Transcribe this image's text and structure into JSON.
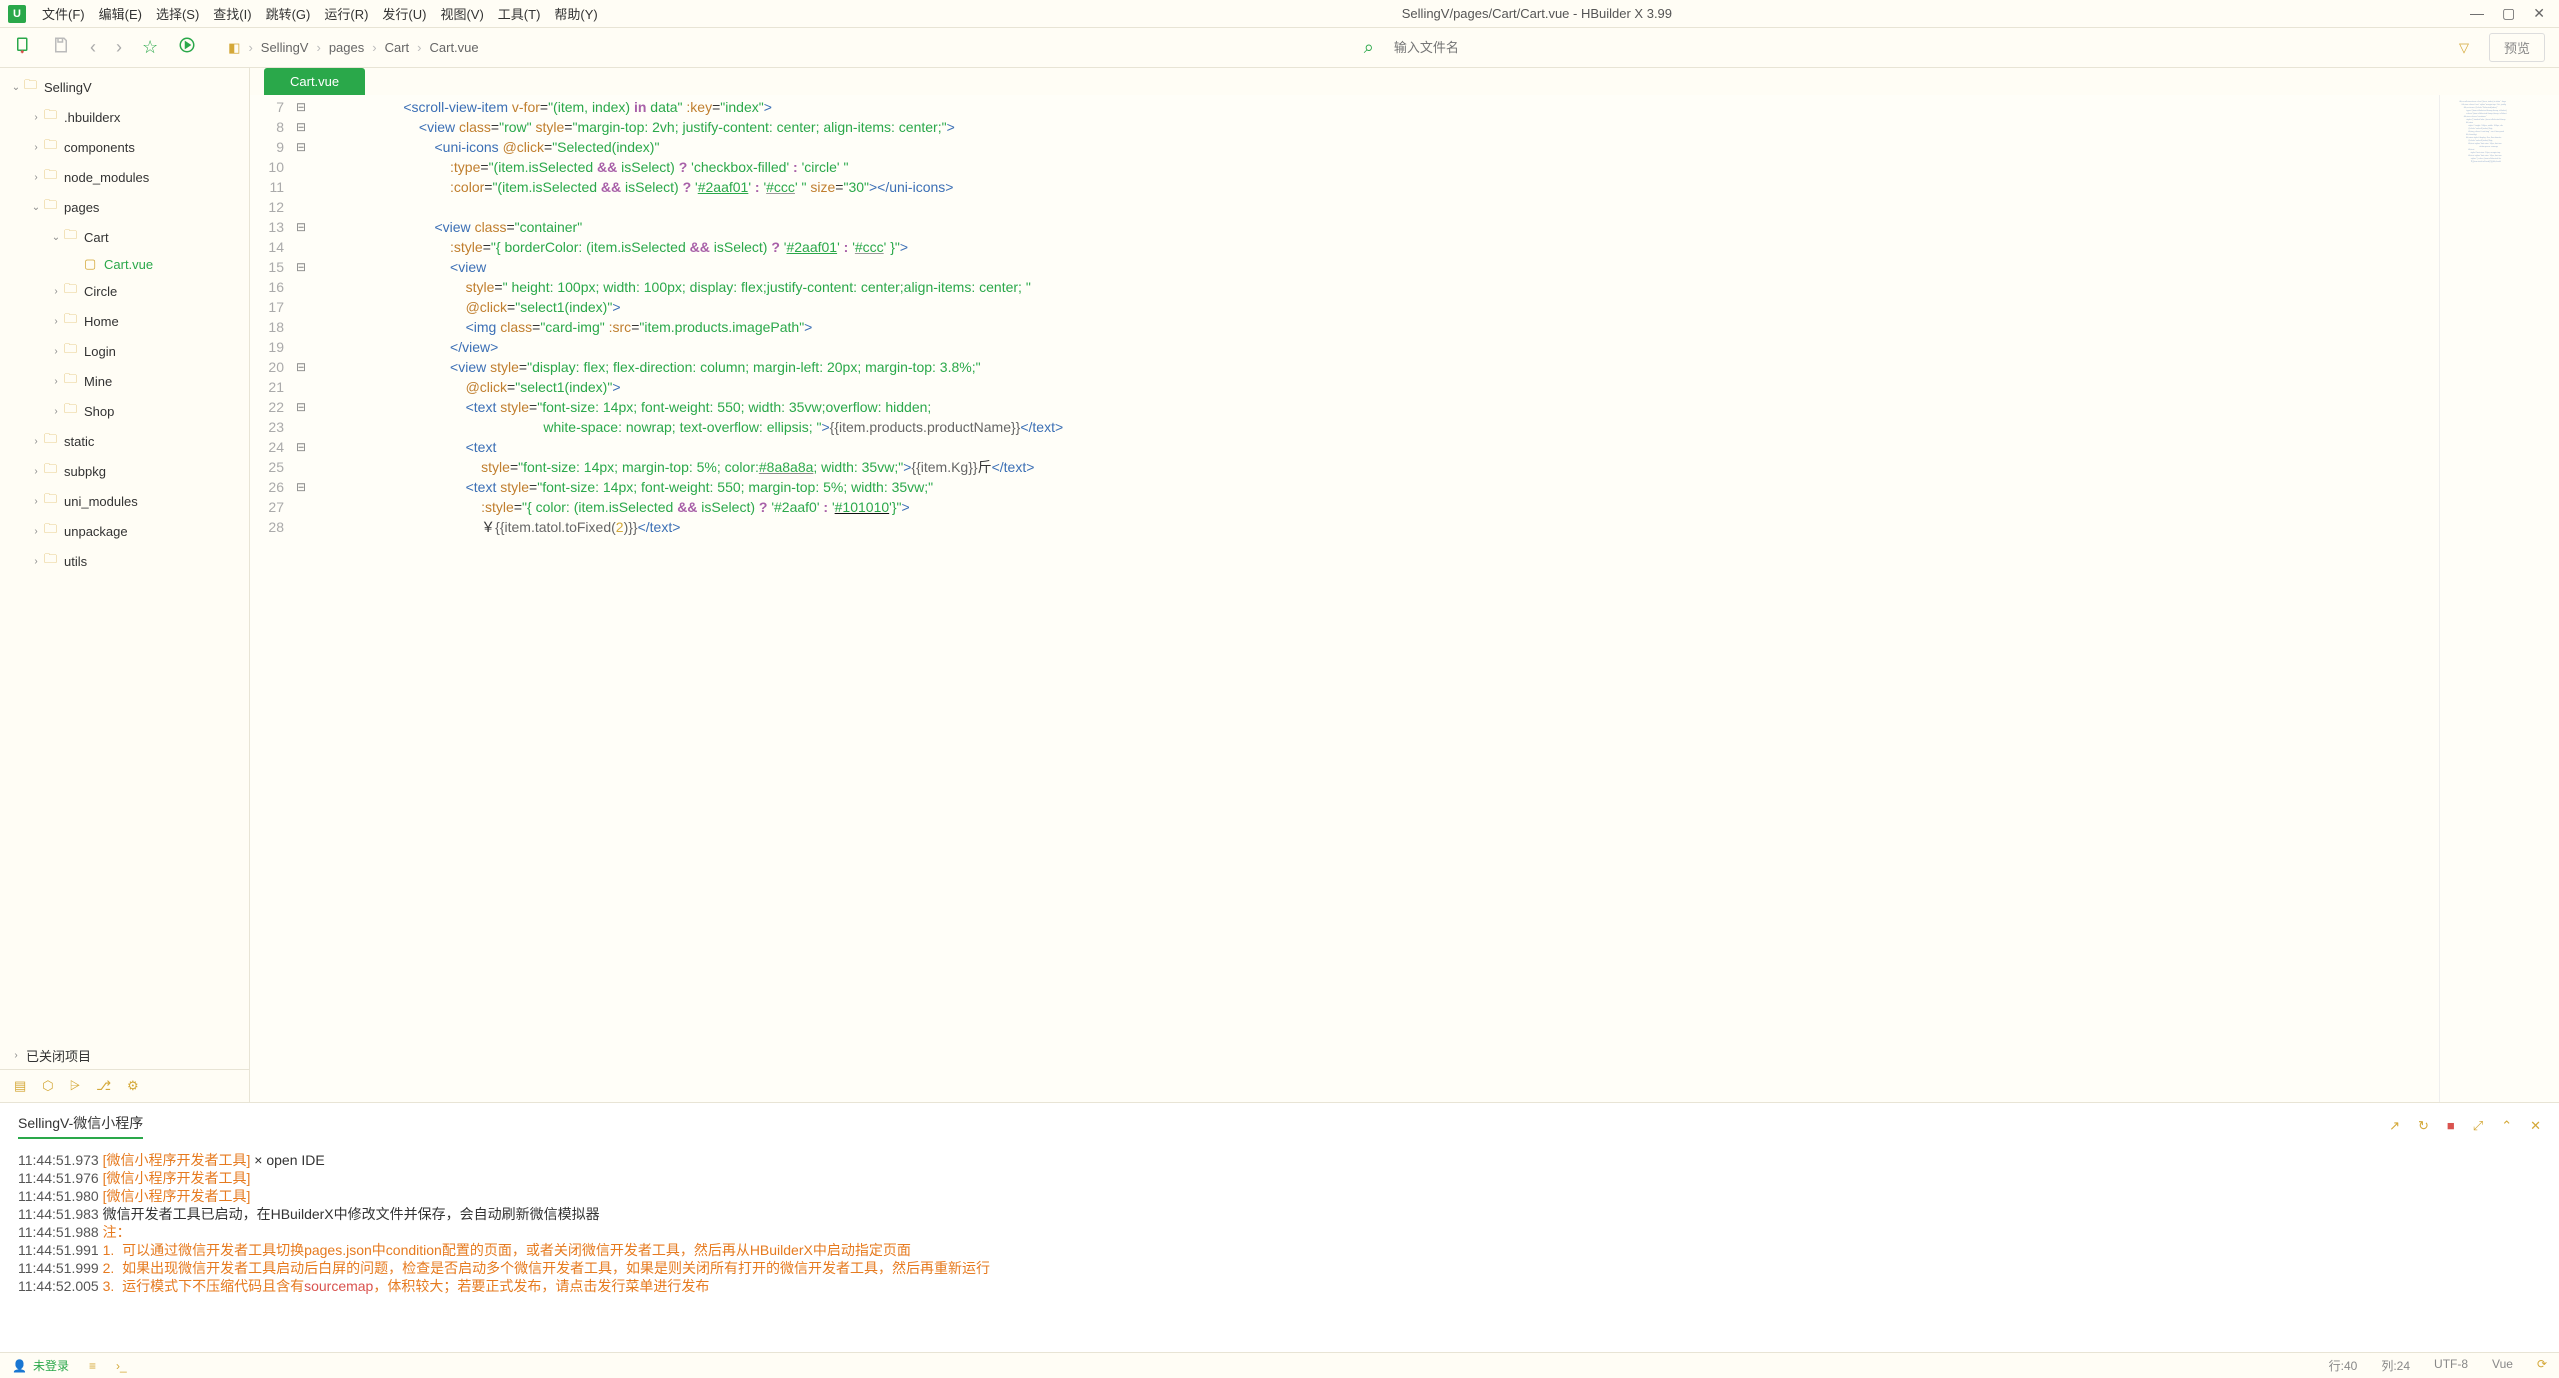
{
  "app": {
    "title": "SellingV/pages/Cart/Cart.vue - HBuilder X 3.99"
  },
  "menubar": {
    "items": [
      {
        "label": "文件(F)"
      },
      {
        "label": "编辑(E)"
      },
      {
        "label": "选择(S)"
      },
      {
        "label": "查找(I)"
      },
      {
        "label": "跳转(G)"
      },
      {
        "label": "运行(R)"
      },
      {
        "label": "发行(U)"
      },
      {
        "label": "视图(V)"
      },
      {
        "label": "工具(T)"
      },
      {
        "label": "帮助(Y)"
      }
    ]
  },
  "toolbar": {
    "search_placeholder": "输入文件名",
    "preview_label": "预览"
  },
  "breadcrumb": {
    "items": [
      "SellingV",
      "pages",
      "Cart",
      "Cart.vue"
    ]
  },
  "sidebar": {
    "items": [
      {
        "indent": 0,
        "chevron": "down",
        "icon": "proj",
        "label": "SellingV"
      },
      {
        "indent": 1,
        "chevron": "right",
        "icon": "folder",
        "label": ".hbuilderx"
      },
      {
        "indent": 1,
        "chevron": "right",
        "icon": "folder",
        "label": "components"
      },
      {
        "indent": 1,
        "chevron": "right",
        "icon": "folder",
        "label": "node_modules"
      },
      {
        "indent": 1,
        "chevron": "down",
        "icon": "folder",
        "label": "pages"
      },
      {
        "indent": 2,
        "chevron": "down",
        "icon": "folder",
        "label": "Cart"
      },
      {
        "indent": 3,
        "chevron": "",
        "icon": "file",
        "label": "Cart.vue",
        "active": true
      },
      {
        "indent": 2,
        "chevron": "right",
        "icon": "folder",
        "label": "Circle"
      },
      {
        "indent": 2,
        "chevron": "right",
        "icon": "folder",
        "label": "Home"
      },
      {
        "indent": 2,
        "chevron": "right",
        "icon": "folder",
        "label": "Login"
      },
      {
        "indent": 2,
        "chevron": "right",
        "icon": "folder",
        "label": "Mine"
      },
      {
        "indent": 2,
        "chevron": "right",
        "icon": "folder",
        "label": "Shop"
      },
      {
        "indent": 1,
        "chevron": "right",
        "icon": "folder",
        "label": "static"
      },
      {
        "indent": 1,
        "chevron": "right",
        "icon": "folder",
        "label": "subpkg"
      },
      {
        "indent": 1,
        "chevron": "right",
        "icon": "folder",
        "label": "uni_modules"
      },
      {
        "indent": 1,
        "chevron": "right",
        "icon": "folder",
        "label": "unpackage"
      },
      {
        "indent": 1,
        "chevron": "right",
        "icon": "folder",
        "label": "utils"
      }
    ],
    "closed_projects": "已关闭项目"
  },
  "tabs": {
    "active": "Cart.vue"
  },
  "editor": {
    "lines": [
      {
        "n": 7,
        "fold": "−",
        "html": "                        <span class='tag-bracket'>&lt;</span><span class='tag-name'>scroll-view-item</span> <span class='attr-name'>v-for</span>=<span class='attr-val'>\"(item, index) </span><span class='keyword'>in</span><span class='attr-val'> data\"</span> <span class='attr-name'>:key</span>=<span class='attr-val'>\"index\"</span><span class='tag-bracket'>&gt;</span>"
      },
      {
        "n": 8,
        "fold": "−",
        "html": "                            <span class='tag-bracket'>&lt;</span><span class='tag-name'>view</span> <span class='attr-name'>class</span>=<span class='attr-val'>\"row\"</span> <span class='attr-name'>style</span>=<span class='attr-val'>\"margin-top: 2vh; justify-content: center; align-items: center;\"</span><span class='tag-bracket'>&gt;</span>"
      },
      {
        "n": 9,
        "fold": "−",
        "html": "                                <span class='tag-bracket'>&lt;</span><span class='tag-name'>uni-icons</span> <span class='attr-name'>@click</span>=<span class='attr-val'>\"Selected(index)\"</span>"
      },
      {
        "n": 10,
        "fold": "",
        "html": "                                    <span class='attr-name'>:type</span>=<span class='attr-val'>\"(item.isSelected </span><span class='keyword'>&amp;&amp;</span><span class='attr-val'> isSelect) </span><span class='keyword'>?</span><span class='attr-val'> 'checkbox-filled' </span><span class='keyword'>:</span><span class='attr-val'> 'circle' \"</span>"
      },
      {
        "n": 11,
        "fold": "",
        "html": "                                    <span class='attr-name'>:color</span>=<span class='attr-val'>\"(item.isSelected </span><span class='keyword'>&amp;&amp;</span><span class='attr-val'> isSelect) </span><span class='keyword'>?</span><span class='attr-val'> '</span><span class='hex-green'>#2aaf01</span><span class='attr-val'>' </span><span class='keyword'>:</span><span class='attr-val'> '</span><span class='hex-ccc'>#ccc</span><span class='attr-val'>' \"</span> <span class='attr-name'>size</span>=<span class='attr-val'>\"30\"</span><span class='tag-bracket'>&gt;&lt;/</span><span class='tag-name'>uni-icons</span><span class='tag-bracket'>&gt;</span>"
      },
      {
        "n": 12,
        "fold": "",
        "html": ""
      },
      {
        "n": 13,
        "fold": "−",
        "html": "                                <span class='tag-bracket'>&lt;</span><span class='tag-name'>view</span> <span class='attr-name'>class</span>=<span class='attr-val'>\"container\"</span>"
      },
      {
        "n": 14,
        "fold": "",
        "html": "                                    <span class='attr-name'>:style</span>=<span class='attr-val'>\"{ borderColor: (item.isSelected </span><span class='keyword'>&amp;&amp;</span><span class='attr-val'> isSelect) </span><span class='keyword'>?</span><span class='attr-val'> '</span><span class='hex-green'>#2aaf01</span><span class='attr-val'>' </span><span class='keyword'>:</span><span class='attr-val'> '</span><span class='hex-ccc'>#ccc</span><span class='attr-val'>' }\"</span><span class='tag-bracket'>&gt;</span>"
      },
      {
        "n": 15,
        "fold": "−",
        "html": "                                    <span class='tag-bracket'>&lt;</span><span class='tag-name'>view</span>"
      },
      {
        "n": 16,
        "fold": "",
        "html": "                                        <span class='attr-name'>style</span>=<span class='attr-val'>\" height: 100px; width: 100px; display: flex;justify-content: center;align-items: center; \"</span>"
      },
      {
        "n": 17,
        "fold": "",
        "html": "                                        <span class='attr-name'>@click</span>=<span class='attr-val'>\"select1(index)\"</span><span class='tag-bracket'>&gt;</span>"
      },
      {
        "n": 18,
        "fold": "",
        "html": "                                        <span class='tag-bracket'>&lt;</span><span class='tag-name'>img</span> <span class='attr-name'>class</span>=<span class='attr-val'>\"card-img\"</span> <span class='attr-name'>:src</span>=<span class='attr-val'>\"item.products.imagePath\"</span><span class='tag-bracket'>&gt;</span>"
      },
      {
        "n": 19,
        "fold": "",
        "html": "                                    <span class='tag-bracket'>&lt;/</span><span class='tag-name'>view</span><span class='tag-bracket'>&gt;</span>"
      },
      {
        "n": 20,
        "fold": "−",
        "html": "                                    <span class='tag-bracket'>&lt;</span><span class='tag-name'>view</span> <span class='attr-name'>style</span>=<span class='attr-val'>\"display: flex; flex-direction: column; margin-left: 20px; margin-top: 3.8%;\"</span>"
      },
      {
        "n": 21,
        "fold": "",
        "html": "                                        <span class='attr-name'>@click</span>=<span class='attr-val'>\"select1(index)\"</span><span class='tag-bracket'>&gt;</span>"
      },
      {
        "n": 22,
        "fold": "−",
        "html": "                                        <span class='tag-bracket'>&lt;</span><span class='tag-name'>text</span> <span class='attr-name'>style</span>=<span class='attr-val'>\"font-size: 14px; font-weight: 550; width: 35vw;overflow: hidden;</span>"
      },
      {
        "n": 23,
        "fold": "",
        "html": "                                                            <span class='attr-val'>white-space: nowrap; text-overflow: ellipsis; \"</span><span class='tag-bracket'>&gt;</span><span class='embedded'>{{item.products.productName}}</span><span class='tag-bracket'>&lt;/</span><span class='tag-name'>text</span><span class='tag-bracket'>&gt;</span>"
      },
      {
        "n": 24,
        "fold": "−",
        "html": "                                        <span class='tag-bracket'>&lt;</span><span class='tag-name'>text</span>"
      },
      {
        "n": 25,
        "fold": "",
        "html": "                                            <span class='attr-name'>style</span>=<span class='attr-val'>\"font-size: 14px; margin-top: 5%; color:</span><span class='hex-gray'>#8a8a8a</span><span class='attr-val'>; width: 35vw;\"</span><span class='tag-bracket'>&gt;</span><span class='embedded'>{{item.Kg}}</span>斤<span class='tag-bracket'>&lt;/</span><span class='tag-name'>text</span><span class='tag-bracket'>&gt;</span>"
      },
      {
        "n": 26,
        "fold": "−",
        "html": "                                        <span class='tag-bracket'>&lt;</span><span class='tag-name'>text</span> <span class='attr-name'>style</span>=<span class='attr-val'>\"font-size: 14px; font-weight: 550; margin-top: 5%; width: 35vw;\"</span>"
      },
      {
        "n": 27,
        "fold": "",
        "html": "                                            <span class='attr-name'>:style</span>=<span class='attr-val'>\"{ color: (item.isSelected </span><span class='keyword'>&amp;&amp;</span><span class='attr-val'> isSelect) </span><span class='keyword'>?</span><span class='attr-val'> '#2aaf0' </span><span class='keyword'>:</span><span class='attr-val'> '</span><span class='hex-black'>#101010</span><span class='attr-val'>'}\"</span><span class='tag-bracket'>&gt;</span>"
      },
      {
        "n": 28,
        "fold": "",
        "html": "                                            ￥<span class='embedded'>{{item.tatol.toFixed(</span><span class='num'>2</span><span class='embedded'>)}}</span><span class='tag-bracket'>&lt;/</span><span class='tag-name'>text</span><span class='tag-bracket'>&gt;</span>"
      }
    ]
  },
  "console": {
    "title": "SellingV-微信小程序",
    "logs": [
      {
        "ts": "11:44:51.973",
        "src": "[微信小程序开发者工具]",
        "msg": " × open IDE"
      },
      {
        "ts": "11:44:51.976",
        "src": "[微信小程序开发者工具]",
        "msg": ""
      },
      {
        "ts": "11:44:51.980",
        "src": "[微信小程序开发者工具]",
        "msg": ""
      },
      {
        "ts": "11:44:51.983",
        "src": "",
        "msg": "微信开发者工具已启动，在HBuilderX中修改文件并保存，会自动刷新微信模拟器"
      },
      {
        "ts": "11:44:51.988",
        "src": "",
        "note": "注："
      },
      {
        "ts": "11:44:51.991",
        "src": "",
        "note": "1.  可以通过微信开发者工具切换pages.json中condition配置的页面，或者关闭微信开发者工具，然后再从HBuilderX中启动指定页面"
      },
      {
        "ts": "11:44:51.999",
        "src": "",
        "note": "2.  如果出现微信开发者工具启动后白屏的问题，检查是否启动多个微信开发者工具，如果是则关闭所有打开的微信开发者工具，然后再重新运行"
      },
      {
        "ts": "11:44:52.005",
        "src": "",
        "richnote": true,
        "p1": "3.  运行模式下不压缩代码且含有",
        "p2": "sourcemap",
        "p3": "，体积较大；若要正式发布，请点击发行菜单进行发布"
      }
    ]
  },
  "statusbar": {
    "login": "未登录",
    "line": "行:40",
    "col": "列:24",
    "encoding": "UTF-8",
    "lang": "Vue"
  }
}
